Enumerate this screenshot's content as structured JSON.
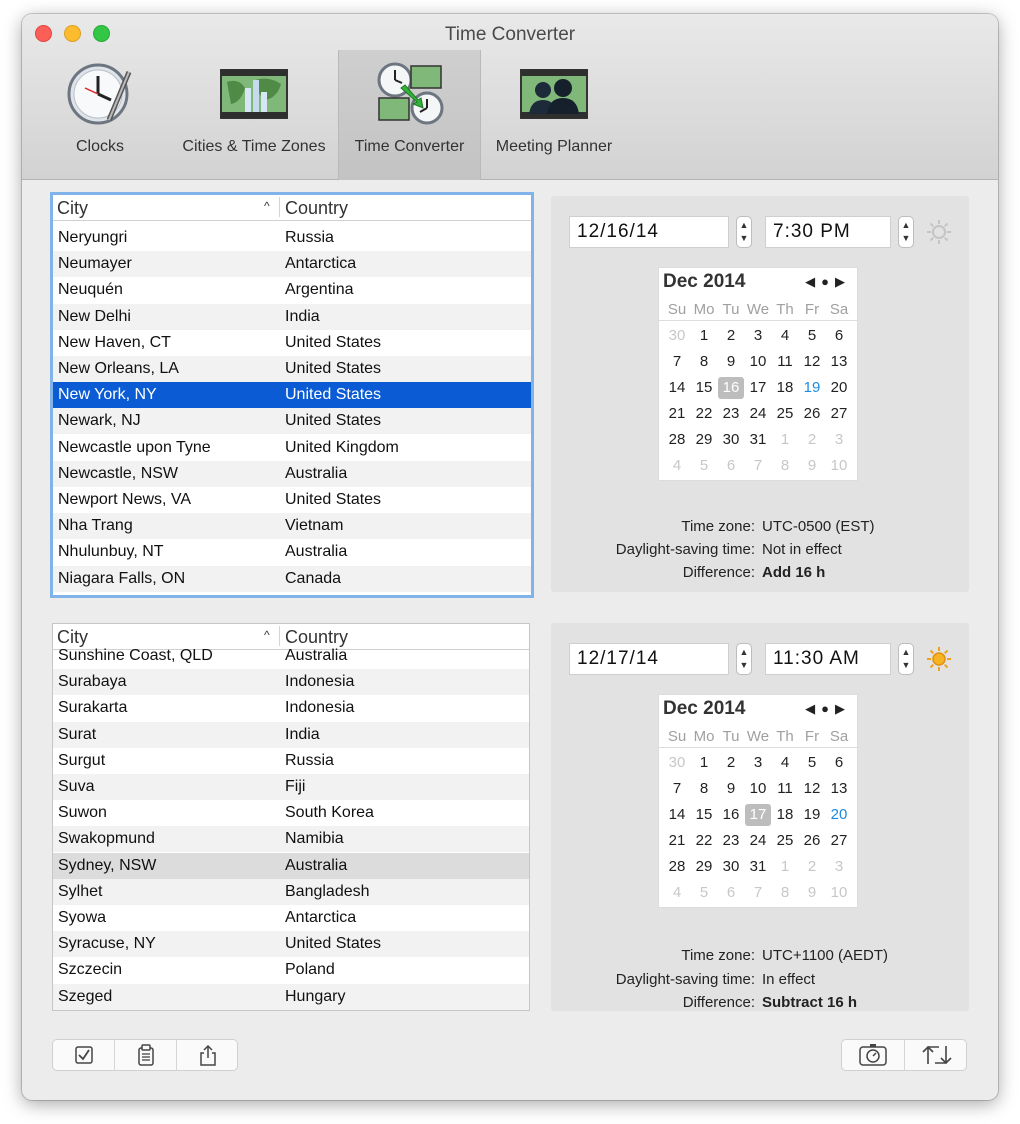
{
  "window": {
    "title": "Time Converter"
  },
  "tabs": [
    {
      "label": "Clocks",
      "icon": "clock-icon"
    },
    {
      "label": "Cities & Time Zones",
      "icon": "world-map-icon"
    },
    {
      "label": "Time Converter",
      "icon": "time-converter-icon",
      "selected": true
    },
    {
      "label": "Meeting Planner",
      "icon": "meeting-planner-icon"
    }
  ],
  "top_table": {
    "headers": {
      "city": "City",
      "country": "Country"
    },
    "rows": [
      {
        "city": "Neryungri",
        "country": "Russia"
      },
      {
        "city": "Neumayer",
        "country": "Antarctica"
      },
      {
        "city": "Neuquén",
        "country": "Argentina"
      },
      {
        "city": "New Delhi",
        "country": "India"
      },
      {
        "city": "New Haven, CT",
        "country": "United States"
      },
      {
        "city": "New Orleans, LA",
        "country": "United States"
      },
      {
        "city": "New York, NY",
        "country": "United States",
        "selected": true
      },
      {
        "city": "Newark, NJ",
        "country": "United States"
      },
      {
        "city": "Newcastle upon Tyne",
        "country": "United Kingdom"
      },
      {
        "city": "Newcastle, NSW",
        "country": "Australia"
      },
      {
        "city": "Newport News, VA",
        "country": "United States"
      },
      {
        "city": "Nha Trang",
        "country": "Vietnam"
      },
      {
        "city": "Nhulunbuy, NT",
        "country": "Australia"
      },
      {
        "city": "Niagara Falls, ON",
        "country": "Canada"
      }
    ]
  },
  "bottom_table": {
    "headers": {
      "city": "City",
      "country": "Country"
    },
    "rows": [
      {
        "city": "Sunshine Coast, QLD",
        "country": "Australia"
      },
      {
        "city": "Surabaya",
        "country": "Indonesia"
      },
      {
        "city": "Surakarta",
        "country": "Indonesia"
      },
      {
        "city": "Surat",
        "country": "India"
      },
      {
        "city": "Surgut",
        "country": "Russia"
      },
      {
        "city": "Suva",
        "country": "Fiji"
      },
      {
        "city": "Suwon",
        "country": "South Korea"
      },
      {
        "city": "Swakopmund",
        "country": "Namibia"
      },
      {
        "city": "Sydney, NSW",
        "country": "Australia",
        "selected": true
      },
      {
        "city": "Sylhet",
        "country": "Bangladesh"
      },
      {
        "city": "Syowa",
        "country": "Antarctica"
      },
      {
        "city": "Syracuse, NY",
        "country": "United States"
      },
      {
        "city": "Szczecin",
        "country": "Poland"
      },
      {
        "city": "Szeged",
        "country": "Hungary"
      }
    ]
  },
  "top_panel": {
    "date": "12/16/14",
    "time": "7:30  PM",
    "daytime_icon": "sun-inactive-icon",
    "calendar": {
      "month": "Dec 2014",
      "dow": [
        "Su",
        "Mo",
        "Tu",
        "We",
        "Th",
        "Fr",
        "Sa"
      ],
      "weeks": [
        [
          "30",
          "1",
          "2",
          "3",
          "4",
          "5",
          "6"
        ],
        [
          "7",
          "8",
          "9",
          "10",
          "11",
          "12",
          "13"
        ],
        [
          "14",
          "15",
          "16",
          "17",
          "18",
          "19",
          "20"
        ],
        [
          "21",
          "22",
          "23",
          "24",
          "25",
          "26",
          "27"
        ],
        [
          "28",
          "29",
          "30",
          "31",
          "1",
          "2",
          "3"
        ],
        [
          "4",
          "5",
          "6",
          "7",
          "8",
          "9",
          "10"
        ]
      ],
      "selected_day": "16",
      "highlight_day": "19"
    },
    "info": {
      "timezone_label": "Time zone:",
      "timezone": "UTC-0500 (EST)",
      "dst_label": "Daylight-saving time:",
      "dst": "Not in effect",
      "diff_label": "Difference:",
      "diff": "Add 16 h"
    }
  },
  "bottom_panel": {
    "date": "12/17/14",
    "time": "11:30  AM",
    "daytime_icon": "sun-active-icon",
    "calendar": {
      "month": "Dec 2014",
      "dow": [
        "Su",
        "Mo",
        "Tu",
        "We",
        "Th",
        "Fr",
        "Sa"
      ],
      "weeks": [
        [
          "30",
          "1",
          "2",
          "3",
          "4",
          "5",
          "6"
        ],
        [
          "7",
          "8",
          "9",
          "10",
          "11",
          "12",
          "13"
        ],
        [
          "14",
          "15",
          "16",
          "17",
          "18",
          "19",
          "20"
        ],
        [
          "21",
          "22",
          "23",
          "24",
          "25",
          "26",
          "27"
        ],
        [
          "28",
          "29",
          "30",
          "31",
          "1",
          "2",
          "3"
        ],
        [
          "4",
          "5",
          "6",
          "7",
          "8",
          "9",
          "10"
        ]
      ],
      "selected_day": "17",
      "highlight_day": "20"
    },
    "info": {
      "timezone_label": "Time zone:",
      "timezone": "UTC+1100 (AEDT)",
      "dst_label": "Daylight-saving time:",
      "dst": "In effect",
      "diff_label": "Difference:",
      "diff": "Subtract 16 h"
    }
  },
  "toolbar_left": [
    "checkbox-icon",
    "clipboard-icon",
    "share-icon"
  ],
  "toolbar_right": [
    "stopwatch-icon",
    "swap-icon"
  ]
}
